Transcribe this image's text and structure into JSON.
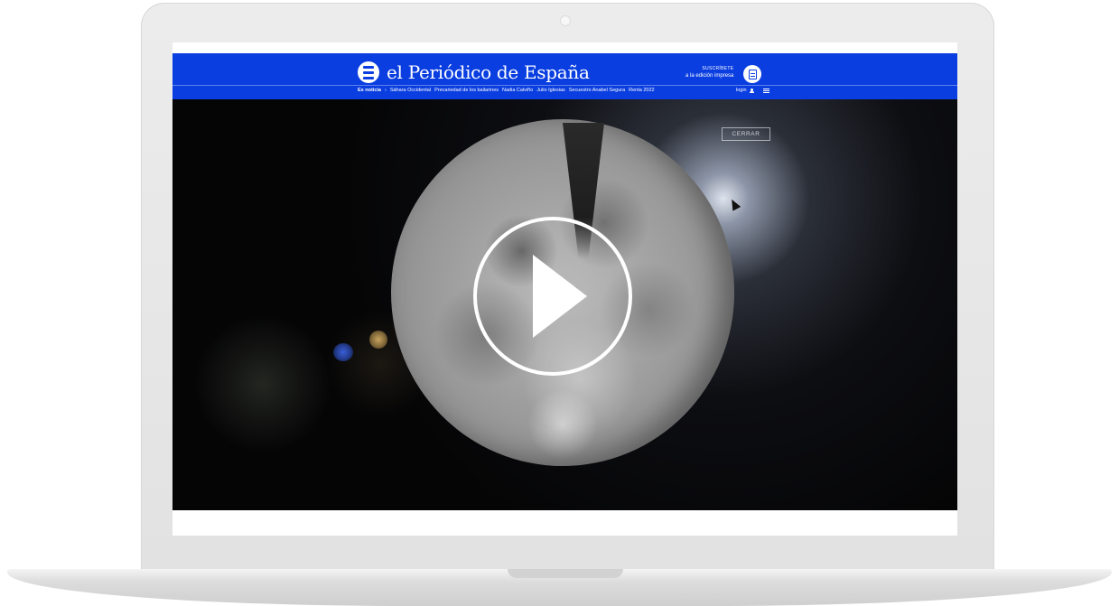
{
  "site": {
    "logo_text": "el Periódico de España",
    "subscribe_line1": "SUSCRÍBETE",
    "subscribe_line2": "a la edición impresa",
    "login_label": "login",
    "brand_color": "#0a3ee0"
  },
  "nav": {
    "lead": "Es noticia",
    "separator": "›",
    "items": [
      "Sáhara Occidental",
      "Precariedad de los bailarines",
      "Nadia Calviño",
      "Julio Iglesias",
      "Secuestro Anabel Segura",
      "Renta 2022"
    ]
  },
  "video": {
    "close_label": "CERRAR",
    "play_icon": "play-icon"
  }
}
